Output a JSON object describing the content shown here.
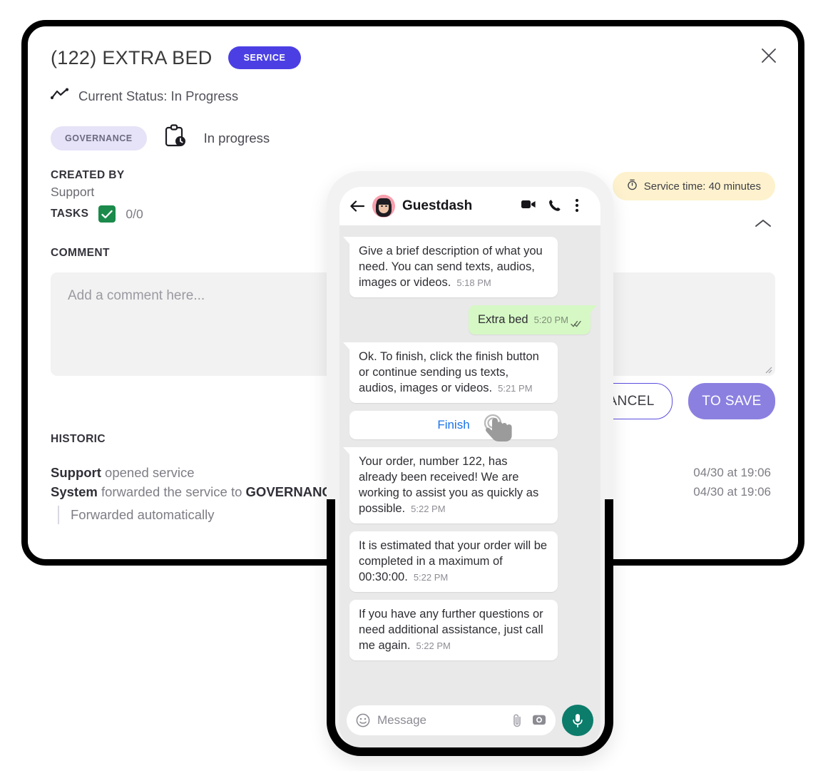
{
  "card": {
    "title": "(122) EXTRA BED",
    "service_badge": "SERVICE",
    "close_icon": "close-icon",
    "status_icon": "trend-line-icon",
    "status_text": "Current Status: In Progress",
    "department_badge": "GOVERNANCE",
    "progress_icon": "clipboard-clock-icon",
    "progress_text": "In progress",
    "created_by_label": "CREATED BY",
    "created_by_value": "Support",
    "tasks_label": "TASKS",
    "tasks_checkbox_icon": "check-icon",
    "tasks_count": "0/0",
    "comment_label": "COMMENT",
    "comment_placeholder": "Add a comment here...",
    "comment_value": "",
    "cancel_label": "CANCEL",
    "save_label": "TO SAVE",
    "service_time_icon": "stopwatch-icon",
    "service_time_text": "Service time: 40 minutes",
    "collapse_icon": "chevron-up-icon",
    "historic_label": "HISTORIC",
    "historic": [
      {
        "actor": "Support",
        "text": " opened service",
        "suffix": "",
        "time": "04/30 at 19:06",
        "sub": ""
      },
      {
        "actor": "System",
        "text": " forwarded the service to ",
        "suffix": "GOVERNANCE",
        "time": "04/30 at 19:06",
        "sub": "Forwarded automatically"
      }
    ]
  },
  "phone": {
    "header": {
      "back_icon": "back-arrow-icon",
      "avatar": "avatar",
      "name": "Guestdash",
      "video_icon": "video-camera-icon",
      "call_icon": "phone-icon",
      "menu_icon": "more-vertical-icon"
    },
    "messages": [
      {
        "side": "in",
        "text": "Give a brief description of what you need. You can send texts, audios, images or videos.",
        "time": "5:18 PM",
        "ticks": false,
        "tail": true
      },
      {
        "side": "out",
        "text": "Extra bed",
        "time": "5:20 PM",
        "ticks": true,
        "tail": true
      },
      {
        "side": "in",
        "text": "Ok. To finish, click the finish button or continue sending us texts, audios, images or videos.",
        "time": "5:21 PM",
        "ticks": false,
        "tail": true
      },
      {
        "side": "in",
        "text": "Your order, number 122, has already been received! We are working to assist you as quickly as possible.",
        "time": "5:22 PM",
        "ticks": false,
        "tail": true
      },
      {
        "side": "in",
        "text": "It is estimated that your order will be completed in a maximum of 00:30:00.",
        "time": "5:22 PM",
        "ticks": false,
        "tail": false
      },
      {
        "side": "in",
        "text": "If you have any further questions or need additional assistance, just call me again.",
        "time": "5:22 PM",
        "ticks": false,
        "tail": false
      }
    ],
    "finish_button": "Finish",
    "cursor_icon": "pointing-hand-cursor-icon",
    "input": {
      "emoji_icon": "emoji-smiley-icon",
      "placeholder": "Message",
      "value": "",
      "attach_icon": "paperclip-icon",
      "camera_icon": "camera-icon",
      "mic_icon": "microphone-icon"
    }
  },
  "colors": {
    "accent_purple": "#4b3fe4",
    "save_purple": "#8b80e0",
    "dept_badge_bg": "#e6e2f7",
    "service_time_bg": "#fdf2cd",
    "task_green": "#1b8a4b",
    "out_bubble_green": "#d6f8c5",
    "link_blue": "#1a73e8",
    "mic_teal": "#0c7c6b"
  }
}
